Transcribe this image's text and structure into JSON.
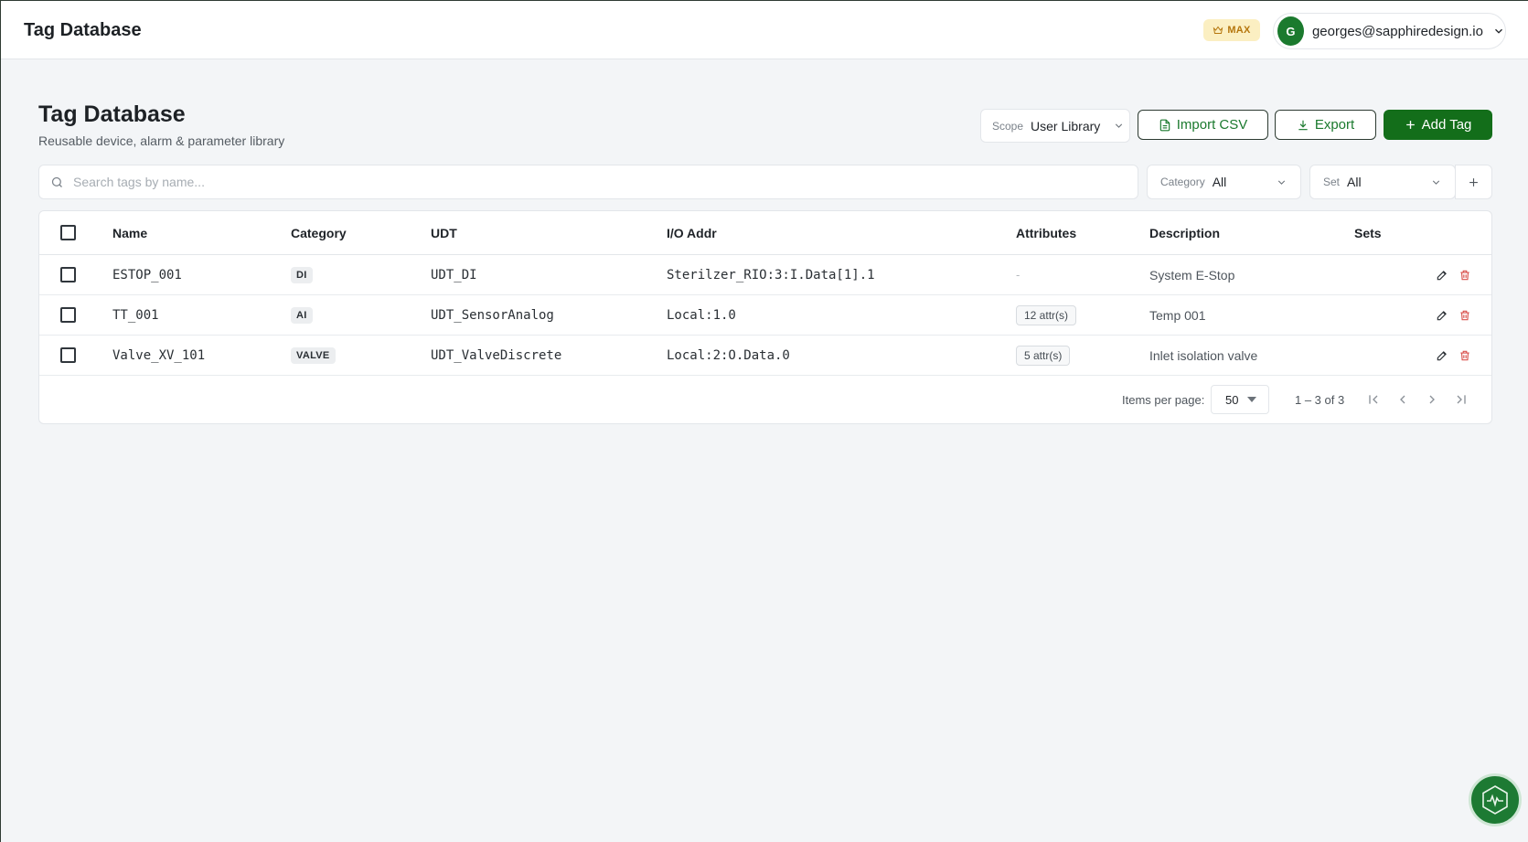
{
  "header": {
    "app_title": "Tag Database",
    "plan_badge": "MAX",
    "user": {
      "initial": "G",
      "email": "georges@sapphiredesign.io"
    }
  },
  "page": {
    "title": "Tag Database",
    "subtitle": "Reusable device, alarm & parameter library"
  },
  "toolbar": {
    "scope_label": "Scope",
    "scope_value": "User Library",
    "import_label": "Import CSV",
    "export_label": "Export",
    "add_label": "Add Tag"
  },
  "filters": {
    "search_placeholder": "Search tags by name...",
    "category_label": "Category",
    "category_value": "All",
    "set_label": "Set",
    "set_value": "All"
  },
  "table": {
    "columns": [
      "Name",
      "Category",
      "UDT",
      "I/O Addr",
      "Attributes",
      "Description",
      "Sets"
    ],
    "rows": [
      {
        "name": "ESTOP_001",
        "category": "DI",
        "udt": "UDT_DI",
        "io_addr": "Sterilzer_RIO:3:I.Data[1].1",
        "attributes": "-",
        "description": "System E-Stop"
      },
      {
        "name": "TT_001",
        "category": "AI",
        "udt": "UDT_SensorAnalog",
        "io_addr": "Local:1.0",
        "attributes": "12 attr(s)",
        "description": "Temp 001"
      },
      {
        "name": "Valve_XV_101",
        "category": "VALVE",
        "udt": "UDT_ValveDiscrete",
        "io_addr": "Local:2:O.Data.0",
        "attributes": "5 attr(s)",
        "description": "Inlet isolation valve"
      }
    ]
  },
  "pagination": {
    "items_per_page_label": "Items per page:",
    "items_per_page": "50",
    "range": "1 – 3 of 3"
  },
  "colors": {
    "brand_green": "#136e1a",
    "delete_red": "#d9534f",
    "badge_gold": "#b5760d"
  }
}
